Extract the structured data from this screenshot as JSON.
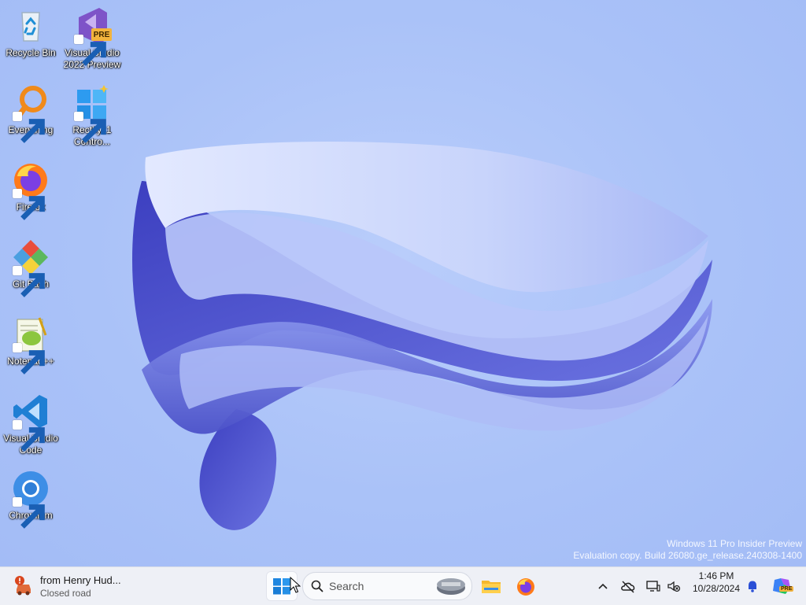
{
  "desktop": {
    "icons": [
      {
        "label": "Recycle Bin"
      },
      {
        "label": "Visual Studio 2022 Preview",
        "badge": "PRE"
      },
      {
        "label": "Everything"
      },
      {
        "label": "Rectify11 Contro..."
      },
      {
        "label": "Firefox"
      },
      {
        "label": "Git Bash"
      },
      {
        "label": "Notepad++"
      },
      {
        "label": "Visual Studio Code"
      },
      {
        "label": "Chromium"
      }
    ],
    "watermark": {
      "line1": "Windows 11 Pro Insider Preview",
      "line2": "Evaluation copy. Build 26080.ge_release.240308-1400"
    }
  },
  "taskbar": {
    "weather": {
      "title": "from Henry Hud...",
      "subtitle": "Closed road"
    },
    "search": {
      "placeholder": "Search"
    },
    "clock": {
      "time": "1:46 PM",
      "date": "10/28/2024"
    },
    "copilot_badge": "PRE"
  },
  "colors": {
    "wallpaper_bg": "#a9c1f8",
    "ribbon_dark": "#4a4fc8",
    "ribbon_light": "#c9d6fb",
    "taskbar_bg": "#eef0f6"
  }
}
